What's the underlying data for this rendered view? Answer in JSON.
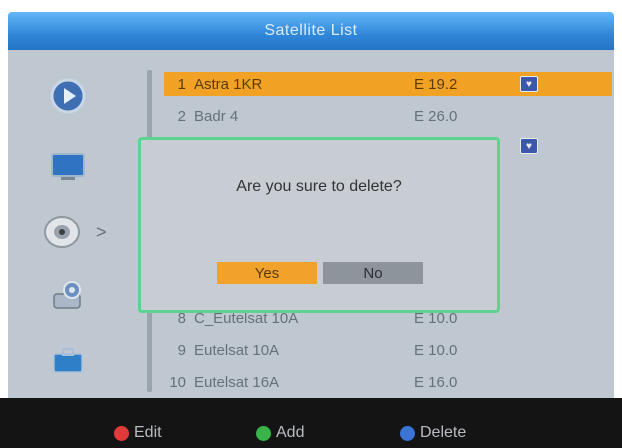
{
  "header": {
    "title": "Satellite List"
  },
  "sidebar": {
    "icons": [
      {
        "name": "play-icon"
      },
      {
        "name": "monitor-icon"
      },
      {
        "name": "satellite-dish-icon",
        "selected": true
      },
      {
        "name": "settings-gear-icon"
      },
      {
        "name": "toolbox-icon"
      }
    ],
    "selected_arrow": ">"
  },
  "satellites": [
    {
      "num": "1",
      "name": "Astra 1KR",
      "pos": "E 19.2",
      "selected": true,
      "marked": true
    },
    {
      "num": "2",
      "name": "Badr 4",
      "pos": "E 26.0",
      "selected": false,
      "marked": false
    },
    {
      "num": "8",
      "name": "C_Eutelsat 10A",
      "pos": "E 10.0",
      "selected": false,
      "marked": false
    },
    {
      "num": "9",
      "name": "Eutelsat 10A",
      "pos": "E 10.0",
      "selected": false,
      "marked": false
    },
    {
      "num": "10",
      "name": "Eutelsat 16A",
      "pos": "E 16.0",
      "selected": false,
      "marked": false
    }
  ],
  "dialog": {
    "message": "Are you sure to delete?",
    "yes_label": "Yes",
    "no_label": "No"
  },
  "footer": {
    "edit_label": "Edit",
    "add_label": "Add",
    "delete_label": "Delete",
    "colors": {
      "edit": "#e03a3a",
      "add": "#39b44a",
      "delete": "#3b73d6"
    }
  }
}
